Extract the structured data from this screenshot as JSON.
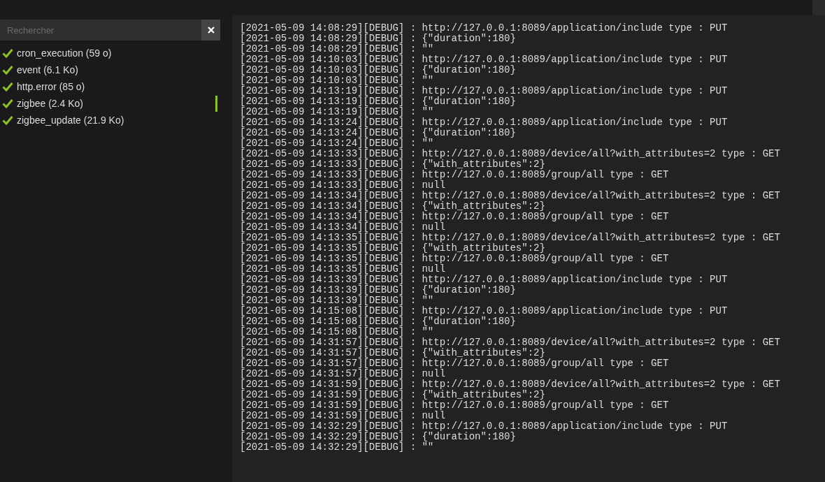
{
  "sidebar": {
    "search": {
      "placeholder": "Rechercher"
    },
    "items": [
      {
        "label": "cron_execution (59 o)",
        "checked": true,
        "selected": false
      },
      {
        "label": "event (6.1 Ko)",
        "checked": true,
        "selected": false
      },
      {
        "label": "http.error (85 o)",
        "checked": true,
        "selected": false
      },
      {
        "label": "zigbee (2.4 Ko)",
        "checked": true,
        "selected": true
      },
      {
        "label": "zigbee_update (21.9 Ko)",
        "checked": true,
        "selected": false
      }
    ]
  },
  "log": {
    "lines": [
      "[2021-05-09 14:08:29][DEBUG] : http://127.0.0.1:8089/application/include type : PUT",
      "[2021-05-09 14:08:29][DEBUG] : {\"duration\":180}",
      "[2021-05-09 14:08:29][DEBUG] : \"\"",
      "[2021-05-09 14:10:03][DEBUG] : http://127.0.0.1:8089/application/include type : PUT",
      "[2021-05-09 14:10:03][DEBUG] : {\"duration\":180}",
      "[2021-05-09 14:10:03][DEBUG] : \"\"",
      "[2021-05-09 14:13:19][DEBUG] : http://127.0.0.1:8089/application/include type : PUT",
      "[2021-05-09 14:13:19][DEBUG] : {\"duration\":180}",
      "[2021-05-09 14:13:19][DEBUG] : \"\"",
      "[2021-05-09 14:13:24][DEBUG] : http://127.0.0.1:8089/application/include type : PUT",
      "[2021-05-09 14:13:24][DEBUG] : {\"duration\":180}",
      "[2021-05-09 14:13:24][DEBUG] : \"\"",
      "[2021-05-09 14:13:33][DEBUG] : http://127.0.0.1:8089/device/all?with_attributes=2 type : GET",
      "[2021-05-09 14:13:33][DEBUG] : {\"with_attributes\":2}",
      "[2021-05-09 14:13:33][DEBUG] : http://127.0.0.1:8089/group/all type : GET",
      "[2021-05-09 14:13:33][DEBUG] : null",
      "[2021-05-09 14:13:34][DEBUG] : http://127.0.0.1:8089/device/all?with_attributes=2 type : GET",
      "[2021-05-09 14:13:34][DEBUG] : {\"with_attributes\":2}",
      "[2021-05-09 14:13:34][DEBUG] : http://127.0.0.1:8089/group/all type : GET",
      "[2021-05-09 14:13:34][DEBUG] : null",
      "[2021-05-09 14:13:35][DEBUG] : http://127.0.0.1:8089/device/all?with_attributes=2 type : GET",
      "[2021-05-09 14:13:35][DEBUG] : {\"with_attributes\":2}",
      "[2021-05-09 14:13:35][DEBUG] : http://127.0.0.1:8089/group/all type : GET",
      "[2021-05-09 14:13:35][DEBUG] : null",
      "[2021-05-09 14:13:39][DEBUG] : http://127.0.0.1:8089/application/include type : PUT",
      "[2021-05-09 14:13:39][DEBUG] : {\"duration\":180}",
      "[2021-05-09 14:13:39][DEBUG] : \"\"",
      "[2021-05-09 14:15:08][DEBUG] : http://127.0.0.1:8089/application/include type : PUT",
      "[2021-05-09 14:15:08][DEBUG] : {\"duration\":180}",
      "[2021-05-09 14:15:08][DEBUG] : \"\"",
      "[2021-05-09 14:31:57][DEBUG] : http://127.0.0.1:8089/device/all?with_attributes=2 type : GET",
      "[2021-05-09 14:31:57][DEBUG] : {\"with_attributes\":2}",
      "[2021-05-09 14:31:57][DEBUG] : http://127.0.0.1:8089/group/all type : GET",
      "[2021-05-09 14:31:57][DEBUG] : null",
      "[2021-05-09 14:31:59][DEBUG] : http://127.0.0.1:8089/device/all?with_attributes=2 type : GET",
      "[2021-05-09 14:31:59][DEBUG] : {\"with_attributes\":2}",
      "[2021-05-09 14:31:59][DEBUG] : http://127.0.0.1:8089/group/all type : GET",
      "[2021-05-09 14:31:59][DEBUG] : null",
      "[2021-05-09 14:32:29][DEBUG] : http://127.0.0.1:8089/application/include type : PUT",
      "[2021-05-09 14:32:29][DEBUG] : {\"duration\":180}",
      "[2021-05-09 14:32:29][DEBUG] : \"\""
    ]
  }
}
